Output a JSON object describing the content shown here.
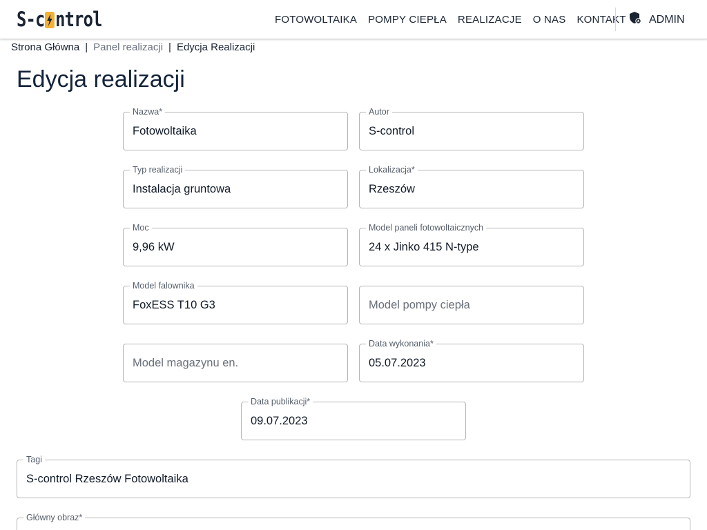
{
  "brand": {
    "logo_left": "S-c",
    "logo_right": "ntrol",
    "accent_color": "#f2b233"
  },
  "nav": {
    "items": [
      "FOTOWOLTAIKA",
      "POMPY CIEPŁA",
      "REALIZACJE",
      "O NAS",
      "KONTAKT"
    ],
    "admin_label": "ADMIN"
  },
  "breadcrumb": {
    "home": "Strona Główna",
    "panel": "Panel realizacji",
    "current": "Edycja Realizacji"
  },
  "page": {
    "title": "Edycja realizacji"
  },
  "form": {
    "nazwa": {
      "label": "Nazwa*",
      "value": "Fotowoltaika"
    },
    "autor": {
      "label": "Autor",
      "value": "S-control"
    },
    "typ": {
      "label": "Typ realizacji",
      "value": "Instalacja gruntowa"
    },
    "lokalizacja": {
      "label": "Lokalizacja*",
      "value": "Rzeszów"
    },
    "moc": {
      "label": "Moc",
      "value": "9,96 kW"
    },
    "model_paneli": {
      "label": "Model paneli fotowoltaicznych",
      "value": "24 x Jinko 415 N-type"
    },
    "model_falownika": {
      "label": "Model falownika",
      "value": "FoxESS T10 G3"
    },
    "model_pompy": {
      "placeholder": "Model pompy ciepła"
    },
    "model_magazynu": {
      "placeholder": "Model magazynu en."
    },
    "data_wykonania": {
      "label": "Data wykonania*",
      "value": "05.07.2023"
    },
    "data_publikacji": {
      "label": "Data publikacji*",
      "value": "09.07.2023"
    },
    "tagi": {
      "label": "Tagi",
      "value": "S-control Rzeszów Fotowoltaika"
    },
    "glowny_obraz": {
      "label": "Główny obraz*"
    }
  }
}
